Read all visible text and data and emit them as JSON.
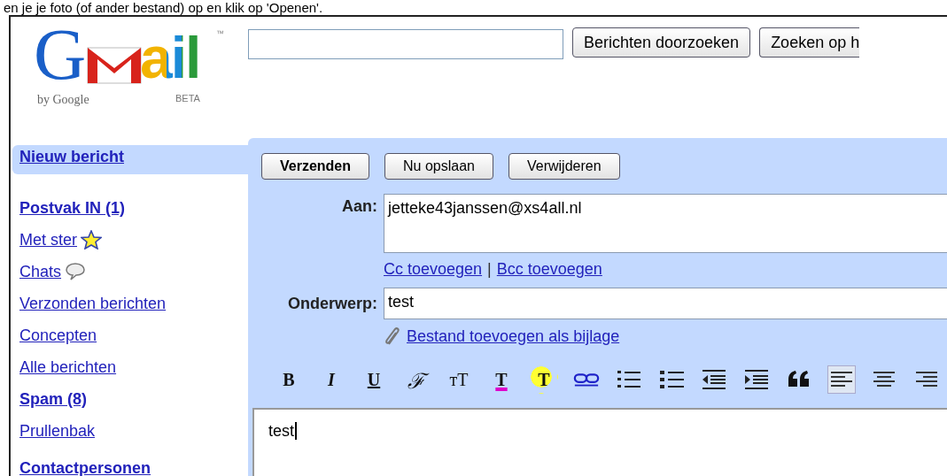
{
  "caption": "en je je foto (of ander bestand) op en klik op 'Openen'.",
  "logo": {
    "lead": "G",
    "tail": "ail",
    "byline": "by Google",
    "badge": "BETA",
    "trademark": "™"
  },
  "search": {
    "buttons": [
      "Berichten doorzoeken",
      "Zoeken op h"
    ]
  },
  "compose_link": {
    "label": "Nieuw bericht",
    "selected": true
  },
  "sidebar": {
    "items": [
      {
        "kind": "plain",
        "label": "Postvak IN (1)",
        "unread": true
      },
      {
        "kind": "starred",
        "label": "Met ster",
        "unread": false
      },
      {
        "kind": "chats",
        "label": "Chats",
        "unread": false
      },
      {
        "kind": "plain",
        "label": "Verzonden berichten",
        "unread": false
      },
      {
        "kind": "plain",
        "label": "Concepten",
        "unread": false
      },
      {
        "kind": "plain",
        "label": "Alle berichten",
        "unread": false
      },
      {
        "kind": "plain",
        "label": "Spam (8)",
        "unread": true
      },
      {
        "kind": "plain",
        "label": "Prullenbak",
        "unread": false
      }
    ],
    "contacts": "Contactpersonen"
  },
  "compose": {
    "buttons": [
      {
        "label": "Verzenden",
        "primary": true
      },
      {
        "label": "Nu opslaan",
        "primary": false
      },
      {
        "label": "Verwijderen",
        "primary": false
      }
    ],
    "to_label": "Aan:",
    "to_value": "jetteke43janssen@xs4all.nl",
    "cc_link": "Cc toevoegen",
    "separator": "|",
    "bcc_link": "Bcc toevoegen",
    "subject_label": "Onderwerp:",
    "subject_value": "test",
    "attach_link": "Bestand toevoegen als bijlage",
    "toolbar": [
      {
        "kind": "bold",
        "label": "B",
        "selected": false
      },
      {
        "kind": "italic",
        "label": "I",
        "selected": false
      },
      {
        "kind": "underline",
        "label": "U",
        "selected": false
      },
      {
        "kind": "font",
        "label": "ℱ",
        "selected": false
      },
      {
        "kind": "size",
        "label": "тT",
        "selected": false
      },
      {
        "kind": "color",
        "label": "T",
        "selected": false
      },
      {
        "kind": "highlight",
        "label": "T",
        "selected": false
      },
      {
        "kind": "link",
        "selected": false
      },
      {
        "kind": "numbered",
        "selected": false
      },
      {
        "kind": "bulleted",
        "selected": false
      },
      {
        "kind": "outdent",
        "selected": false
      },
      {
        "kind": "indent",
        "selected": false
      },
      {
        "kind": "quote",
        "selected": false
      },
      {
        "kind": "align-left",
        "selected": true
      },
      {
        "kind": "align-center",
        "selected": false
      },
      {
        "kind": "align-right",
        "selected": false
      }
    ],
    "body": "test"
  }
}
